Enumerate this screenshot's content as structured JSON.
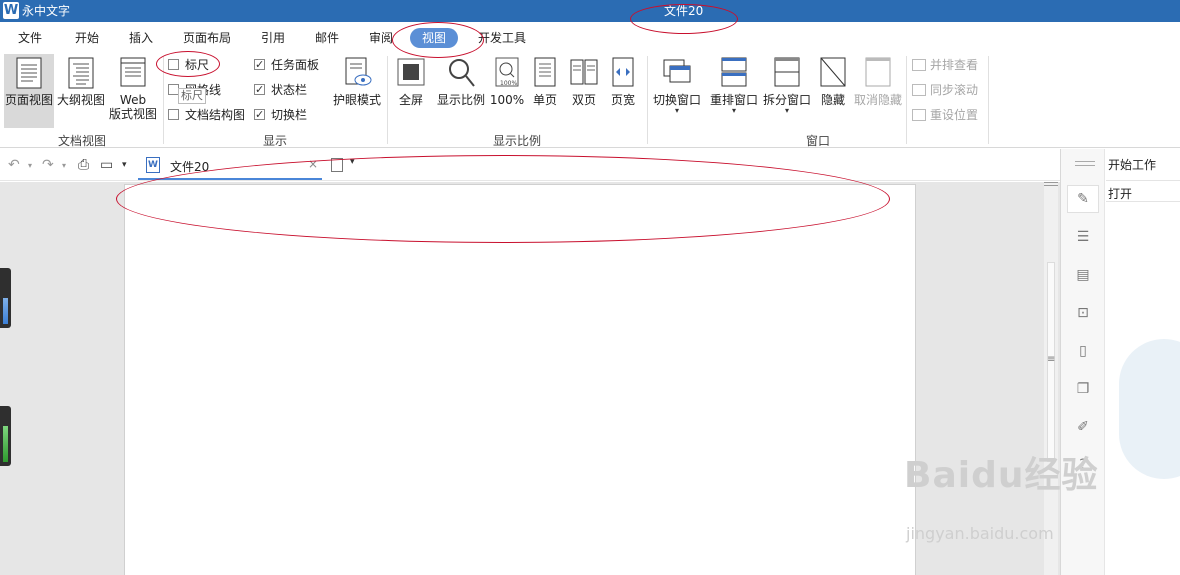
{
  "titlebar": {
    "app_name": "永中文字",
    "doc_title": "文件20",
    "logo": "W"
  },
  "menu": {
    "tabs": [
      "文件",
      "开始",
      "插入",
      "页面布局",
      "引用",
      "邮件",
      "审阅",
      "视图",
      "开发工具"
    ],
    "active": "视图"
  },
  "ribbon": {
    "doc_view": {
      "buttons": [
        "页面视图",
        "大纲视图",
        "Web",
        "版式视图"
      ],
      "group_label": "文档视图"
    },
    "display": {
      "checks": [
        {
          "label": "标尺",
          "checked": false
        },
        {
          "label": "网格线",
          "checked": false
        },
        {
          "label": "文档结构图",
          "checked": false
        },
        {
          "label": "任务面板",
          "checked": true
        },
        {
          "label": "状态栏",
          "checked": true
        },
        {
          "label": "切换栏",
          "checked": true
        }
      ],
      "eye_mode": "护眼模式",
      "group_label": "显示",
      "tooltip": "标尺"
    },
    "zoom": {
      "buttons": [
        "全屏",
        "显示比例",
        "100%",
        "单页",
        "双页",
        "页宽"
      ],
      "group_label": "显示比例"
    },
    "window": {
      "buttons": [
        "切换窗口",
        "重排窗口",
        "拆分窗口",
        "隐藏",
        "取消隐藏"
      ],
      "side_buttons": [
        "并排查看",
        "同步滚动",
        "重设位置"
      ],
      "group_label": "窗口"
    }
  },
  "doc_tab": {
    "label": "文件20",
    "close": "×",
    "dropdown": "▾"
  },
  "right_panel": {
    "title": "开始工作",
    "open": "打开"
  },
  "watermark": {
    "brand": "Baidu经验",
    "url": "jingyan.baidu.com"
  },
  "colors": {
    "titlebar": "#2b6cb3",
    "active_tab": "#5b8fd6",
    "annotation": "#c8102e"
  }
}
